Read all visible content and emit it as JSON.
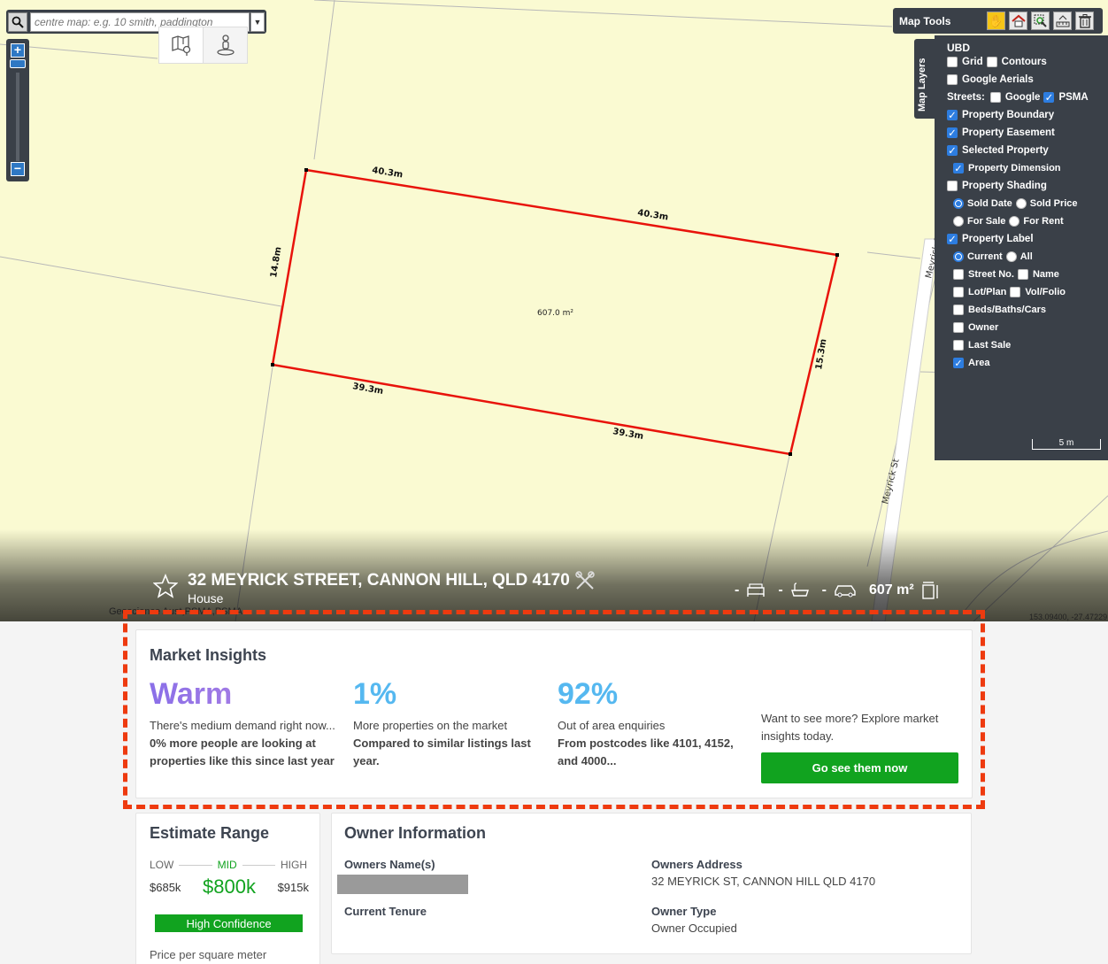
{
  "search": {
    "placeholder": "centre map: e.g. 10 smith, paddington"
  },
  "map_tools": {
    "label": "Map Tools"
  },
  "layers": {
    "tab_label": "Map Layers",
    "title": "UBD",
    "grid": "Grid",
    "contours": "Contours",
    "google_aerials": "Google Aerials",
    "streets_label": "Streets:",
    "google": "Google",
    "psma": "PSMA",
    "property_boundary": "Property Boundary",
    "property_easement": "Property Easement",
    "selected_property": "Selected Property",
    "property_dimension": "Property Dimension",
    "property_shading": "Property Shading",
    "sold_date": "Sold Date",
    "sold_price": "Sold Price",
    "for_sale": "For Sale",
    "for_rent": "For Rent",
    "property_label": "Property Label",
    "current": "Current",
    "all": "All",
    "street_no": "Street No.",
    "name": "Name",
    "lot_plan": "Lot/Plan",
    "vol_folio": "Vol/Folio",
    "beds_baths_cars": "Beds/Baths/Cars",
    "owner": "Owner",
    "last_sale": "Last Sale",
    "area": "Area",
    "scale": "5 m"
  },
  "map_labels": {
    "top_dim": "40.3m",
    "top_dim2": "40.3m",
    "left_dim": "14.8m",
    "right_dim": "15.3m",
    "bottom_dim": "39.3m",
    "bottom_dim2": "39.3m",
    "area": "607.0 m²",
    "street1": "Meyrick St",
    "street2": "Meyrick St"
  },
  "property": {
    "address": "32 MEYRICK STREET, CANNON HILL, QLD 4170",
    "type": "House",
    "beds": "-",
    "baths": "-",
    "cars": "-",
    "land": "607 m²",
    "attribution": "Geoscience Aust,PSMA,PSMA",
    "coords": "153.09400, -27.47229"
  },
  "market_insights": {
    "title": "Market Insights",
    "demand": {
      "value": "Warm",
      "line1": "There's medium demand right now...",
      "line2": "0% more people are looking at properties like this since last year"
    },
    "supply": {
      "value": "1%",
      "line1": "More properties on the market",
      "line2": "Compared to similar listings last year."
    },
    "enquiries": {
      "value": "92%",
      "line1": "Out of area enquiries",
      "line2": "From postcodes like 4101, 4152, and 4000..."
    },
    "cta_text": "Want to see more? Explore market insights today.",
    "cta_button": "Go see them now"
  },
  "estimate": {
    "title": "Estimate Range",
    "low_label": "LOW",
    "mid_label": "MID",
    "high_label": "HIGH",
    "low": "$685k",
    "mid": "$800k",
    "high": "$915k",
    "confidence": "High Confidence",
    "ppsm_label": "Price per square meter"
  },
  "owner": {
    "title": "Owner Information",
    "names_label": "Owners Name(s)",
    "address_label": "Owners Address",
    "address": "32 MEYRICK ST, CANNON HILL QLD 4170",
    "tenure_label": "Current Tenure",
    "type_label": "Owner Type",
    "type": "Owner Occupied"
  }
}
